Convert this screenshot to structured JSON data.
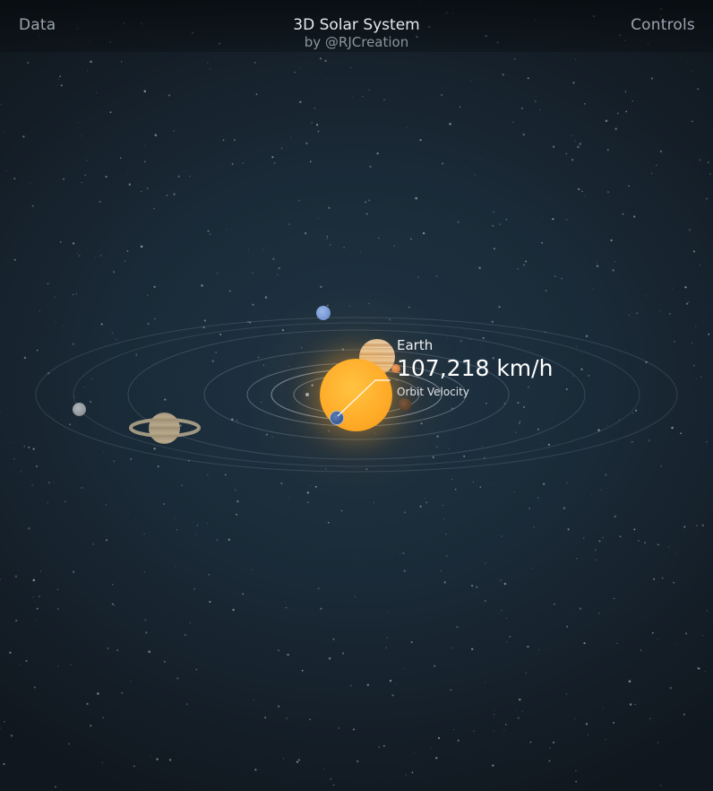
{
  "nav": {
    "left_label": "Data",
    "right_label": "Controls"
  },
  "header": {
    "title": "3D Solar System",
    "subtitle": "by @RJCreation"
  },
  "selected_body": {
    "name": "Earth",
    "metric_value": "107,218 km/h",
    "metric_label": "Orbit Velocity"
  },
  "colors": {
    "sun": "#ffb22e",
    "background": "#1b2631",
    "orbit_line": "#9fb0be"
  },
  "bodies": [
    {
      "name": "sun",
      "icon": "sun-icon"
    },
    {
      "name": "mercury",
      "icon": "planet-icon"
    },
    {
      "name": "venus",
      "icon": "planet-icon"
    },
    {
      "name": "earth",
      "icon": "planet-icon"
    },
    {
      "name": "mars",
      "icon": "planet-icon"
    },
    {
      "name": "jupiter",
      "icon": "planet-icon"
    },
    {
      "name": "saturn",
      "icon": "ringed-planet-icon"
    },
    {
      "name": "uranus",
      "icon": "planet-icon"
    },
    {
      "name": "neptune",
      "icon": "planet-icon"
    }
  ]
}
